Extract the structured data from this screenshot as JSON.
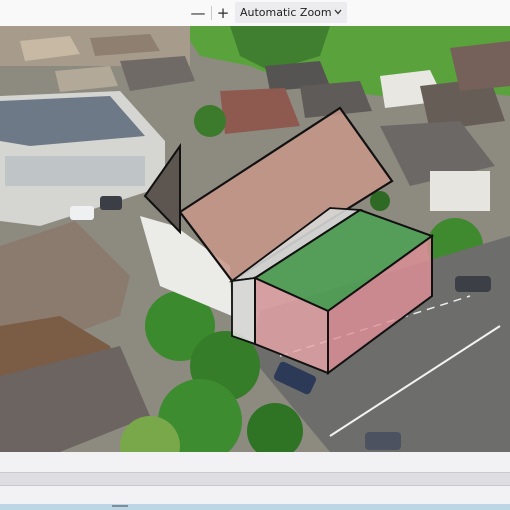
{
  "toolbar": {
    "zoom_out_label": "—",
    "zoom_in_label": "+",
    "zoom_value": "Automatic Zoom"
  },
  "viewer": {
    "image_subject": "aerial photo of a village building with 3D massing overlay"
  },
  "colors": {
    "roof_overlay": "#c8968a",
    "green_box": "#4fa055",
    "pink_box": "#e6a3a8",
    "toolbar_bg": "#f9f9fa",
    "next_page_strip": "#bcd6e6"
  }
}
